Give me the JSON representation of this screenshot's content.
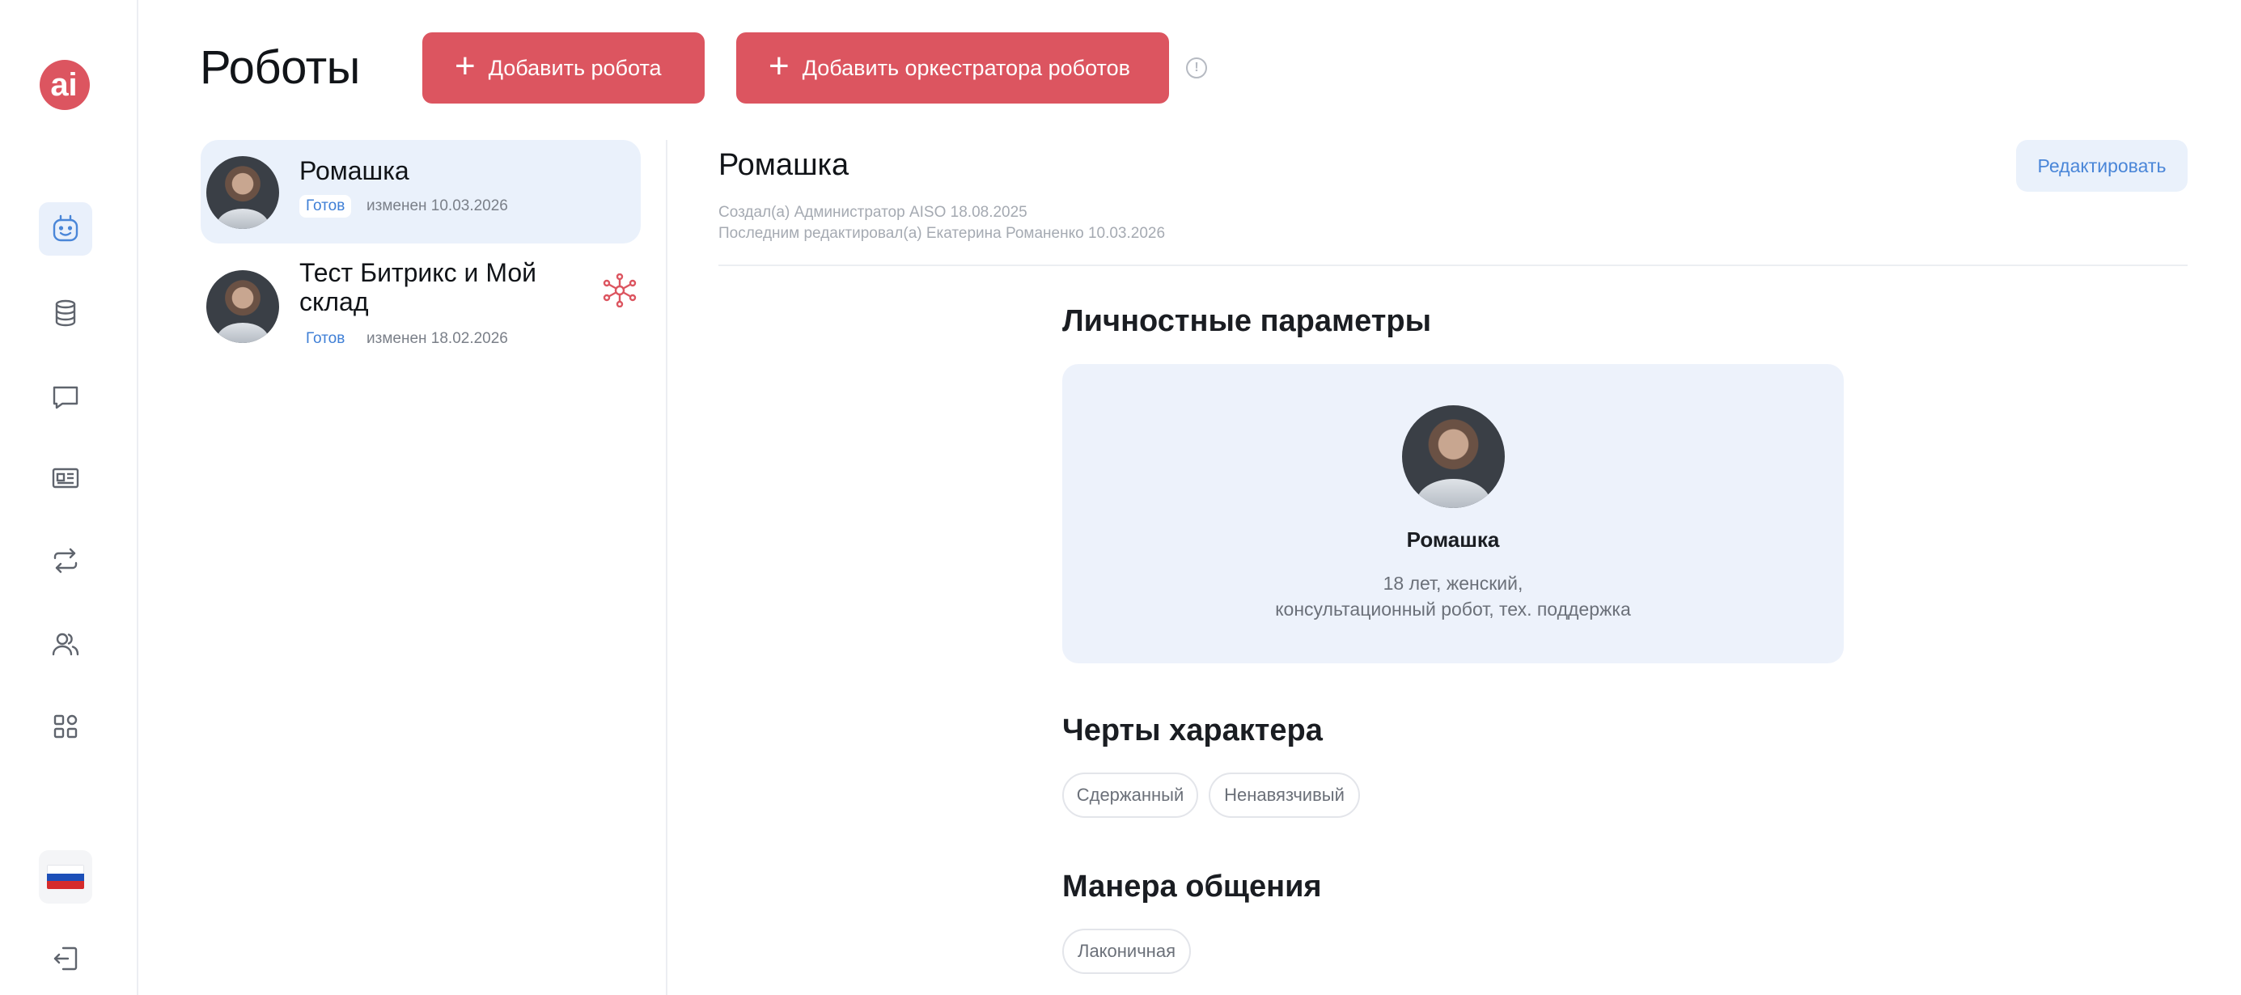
{
  "header": {
    "title": "Роботы",
    "add_robot_label": "Добавить робота",
    "add_orchestrator_label": "Добавить оркестратора роботов",
    "info_symbol": "!"
  },
  "sidebar": {
    "logo_text": "ai",
    "items": [
      {
        "name": "robots",
        "icon": "robot-face-icon",
        "active": true
      },
      {
        "name": "database",
        "icon": "database-icon",
        "active": false
      },
      {
        "name": "chats",
        "icon": "chat-bubble-icon",
        "active": false
      },
      {
        "name": "news",
        "icon": "newspaper-icon",
        "active": false
      },
      {
        "name": "integrations",
        "icon": "repeat-arrows-icon",
        "active": false
      },
      {
        "name": "users",
        "icon": "users-icon",
        "active": false
      },
      {
        "name": "apps",
        "icon": "grid-icon",
        "active": false
      }
    ],
    "language_flag": "russian-flag-icon",
    "logout_icon": "logout-icon"
  },
  "robots": [
    {
      "name": "Ромашка",
      "status": "Готов",
      "modified": "изменен 10.03.2026",
      "selected": true,
      "orchestrator": false
    },
    {
      "name": "Тест Битрикс и Мой склад",
      "status": "Готов",
      "modified": "изменен 18.02.2026",
      "selected": false,
      "orchestrator": true
    }
  ],
  "detail": {
    "title": "Ромашка",
    "edit_label": "Редактировать",
    "created_by": "Создал(а) Администратор AISO 18.08.2025",
    "last_edited_by": "Последним редактировал(а) Екатерина Романенко 10.03.2026",
    "personal_section": "Личностные параметры",
    "persona": {
      "name": "Ромашка",
      "line1": "18 лет, женский,",
      "line2": "консультационный робот, тех. поддержка"
    },
    "traits_section": "Черты характера",
    "traits": [
      "Сдержанный",
      "Ненавязчивый"
    ],
    "manner_section": "Манера общения",
    "manner": [
      "Лаконичная"
    ]
  },
  "colors": {
    "brand_red": "#dc5560",
    "accent_blue": "#4a86d8",
    "selected_bg": "#eaf1fb"
  }
}
